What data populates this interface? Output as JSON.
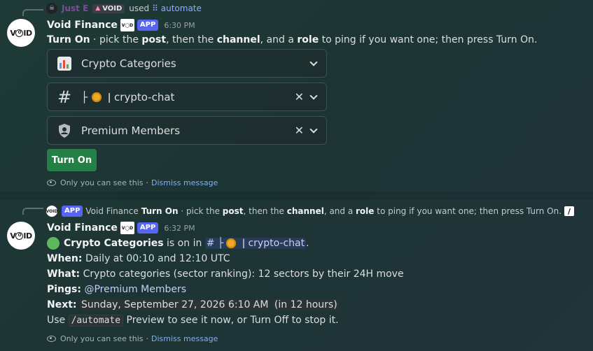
{
  "message1": {
    "reply": {
      "user": "Just E",
      "tag": "VOID",
      "used_text": "used",
      "command": "automate",
      "command_icon": "command-icon"
    },
    "author": "Void Finance",
    "badge": "APP",
    "time": "6:30 PM",
    "instruction": {
      "turn_on": "Turn On",
      "t1": " · pick the ",
      "post": "post",
      "t2": ", then the ",
      "channel": "channel",
      "t3": ", and a ",
      "role": "role",
      "t4": " to ping if you want one; then press Turn On."
    },
    "selects": [
      {
        "label": "Crypto Categories",
        "icon": "bar-chart-icon"
      },
      {
        "label": "crypto-chat",
        "prefix": "├",
        "sep": "ǀ",
        "icon": "hash-icon"
      },
      {
        "label": "Premium Members",
        "icon": "role-shield-icon"
      }
    ],
    "button_label": "Turn On",
    "ephemeral": "Only you can see this",
    "dismiss": "Dismiss message"
  },
  "message2": {
    "reply": {
      "badge": "APP",
      "author": "Void Finance",
      "turn_on": "Turn On",
      "t1": " · pick the ",
      "post": "post",
      "t2": ", then the ",
      "channel": "channel",
      "t3": ", and a ",
      "role": "role",
      "t4": " to ping if you want one; then press Turn On."
    },
    "author": "Void Finance",
    "badge": "APP",
    "time": "6:32 PM",
    "status": {
      "name": "Crypto Categories",
      "text": " is on in ",
      "channel_prefix": "├",
      "channel_sep": "ǀ",
      "channel": "crypto-chat",
      "end": "."
    },
    "when_label": "When:",
    "when_value": "Daily at 00:10 and 12:10 UTC",
    "what_label": "What:",
    "what_value": "Crypto categories (sector ranking): 12 sectors by their 24H move",
    "pings_label": "Pings:",
    "pings_value": "@Premium Members",
    "next_label": "Next:",
    "next_value": "Sunday, September 27, 2026 6:10 AM",
    "next_rel": "in 12 hours",
    "use_text": "Use",
    "use_cmd": "/automate",
    "use_rest": "Preview to see it now, or Turn Off to stop it.",
    "ephemeral": "Only you can see this",
    "dismiss": "Dismiss message"
  },
  "colors": {
    "app_badge": "#5865f2",
    "button": "#248046",
    "link": "#7fb0f0",
    "mention": "#c9cdfb"
  }
}
